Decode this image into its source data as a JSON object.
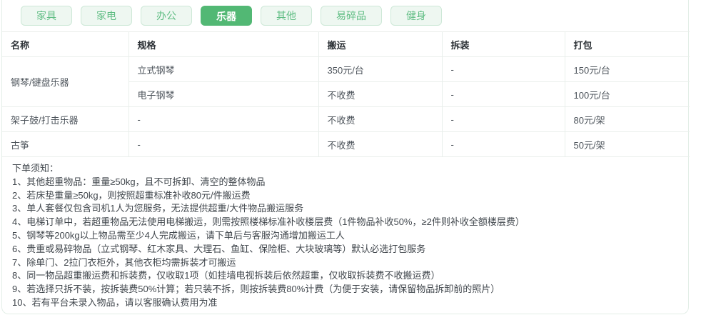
{
  "colors": {
    "accent_green": "#52b874",
    "tab_background": "#eef7f1",
    "tab_border": "#cde8d7",
    "tab_text": "#5fbd83",
    "table_border": "#e9efeb"
  },
  "tabs": {
    "items": [
      {
        "label": "家具",
        "active": false
      },
      {
        "label": "家电",
        "active": false
      },
      {
        "label": "办公",
        "active": false
      },
      {
        "label": "乐器",
        "active": true
      },
      {
        "label": "其他",
        "active": false
      },
      {
        "label": "易碎品",
        "active": false
      },
      {
        "label": "健身",
        "active": false
      }
    ]
  },
  "table": {
    "columns": [
      "名称",
      "规格",
      "搬运",
      "拆装",
      "打包"
    ],
    "rows": [
      {
        "name": "钢琴/键盘乐器",
        "spec": "立式钢琴",
        "carry": "350元/台",
        "disassembly": "-",
        "pack": "150元/台"
      },
      {
        "name": "钢琴/键盘乐器",
        "spec": "电子钢琴",
        "carry": "不收费",
        "disassembly": "-",
        "pack": "100元/台"
      },
      {
        "name": "架子鼓/打击乐器",
        "spec": "-",
        "carry": "不收费",
        "disassembly": "-",
        "pack": "80元/架"
      },
      {
        "name": "古筝",
        "spec": "-",
        "carry": "不收费",
        "disassembly": "-",
        "pack": "50元/架"
      }
    ]
  },
  "notes": {
    "title": "下单须知：",
    "items": [
      "1、其他超重物品：重量≥50kg，且不可拆卸、清空的整体物品",
      "2、若床垫重量≥50kg，则按照超重标准补收80元/件搬运费",
      "3、单人套餐仅包含司机1人为您服务，无法提供超重/大件物品搬运服务",
      "4、电梯订单中，若超重物品无法使用电梯搬运，则需按照楼梯标准补收楼层费（1件物品补收50%，≥2件则补收全额楼层费）",
      "5、钢琴等200kg以上物品需至少4人完成搬运，请下单后与客服沟通增加搬运工人",
      "6、贵重或易碎物品（立式钢琴、红木家具、大理石、鱼缸、保险柜、大块玻璃等）默认必选打包服务",
      "7、除单门、2拉门衣柜外，其他衣柜均需拆装才可搬运",
      "8、同一物品超重搬运费和拆装费，仅收取1项（如挂墙电视拆装后依然超重，仅收取拆装费不收搬运费）",
      "9、若选择只拆不装，按拆装费50%计算；若只装不拆，则按拆装费80%计费（为便于安装，请保留物品拆卸前的照片）",
      "10、若有平台未录入物品，请以客服确认费用为准"
    ]
  }
}
